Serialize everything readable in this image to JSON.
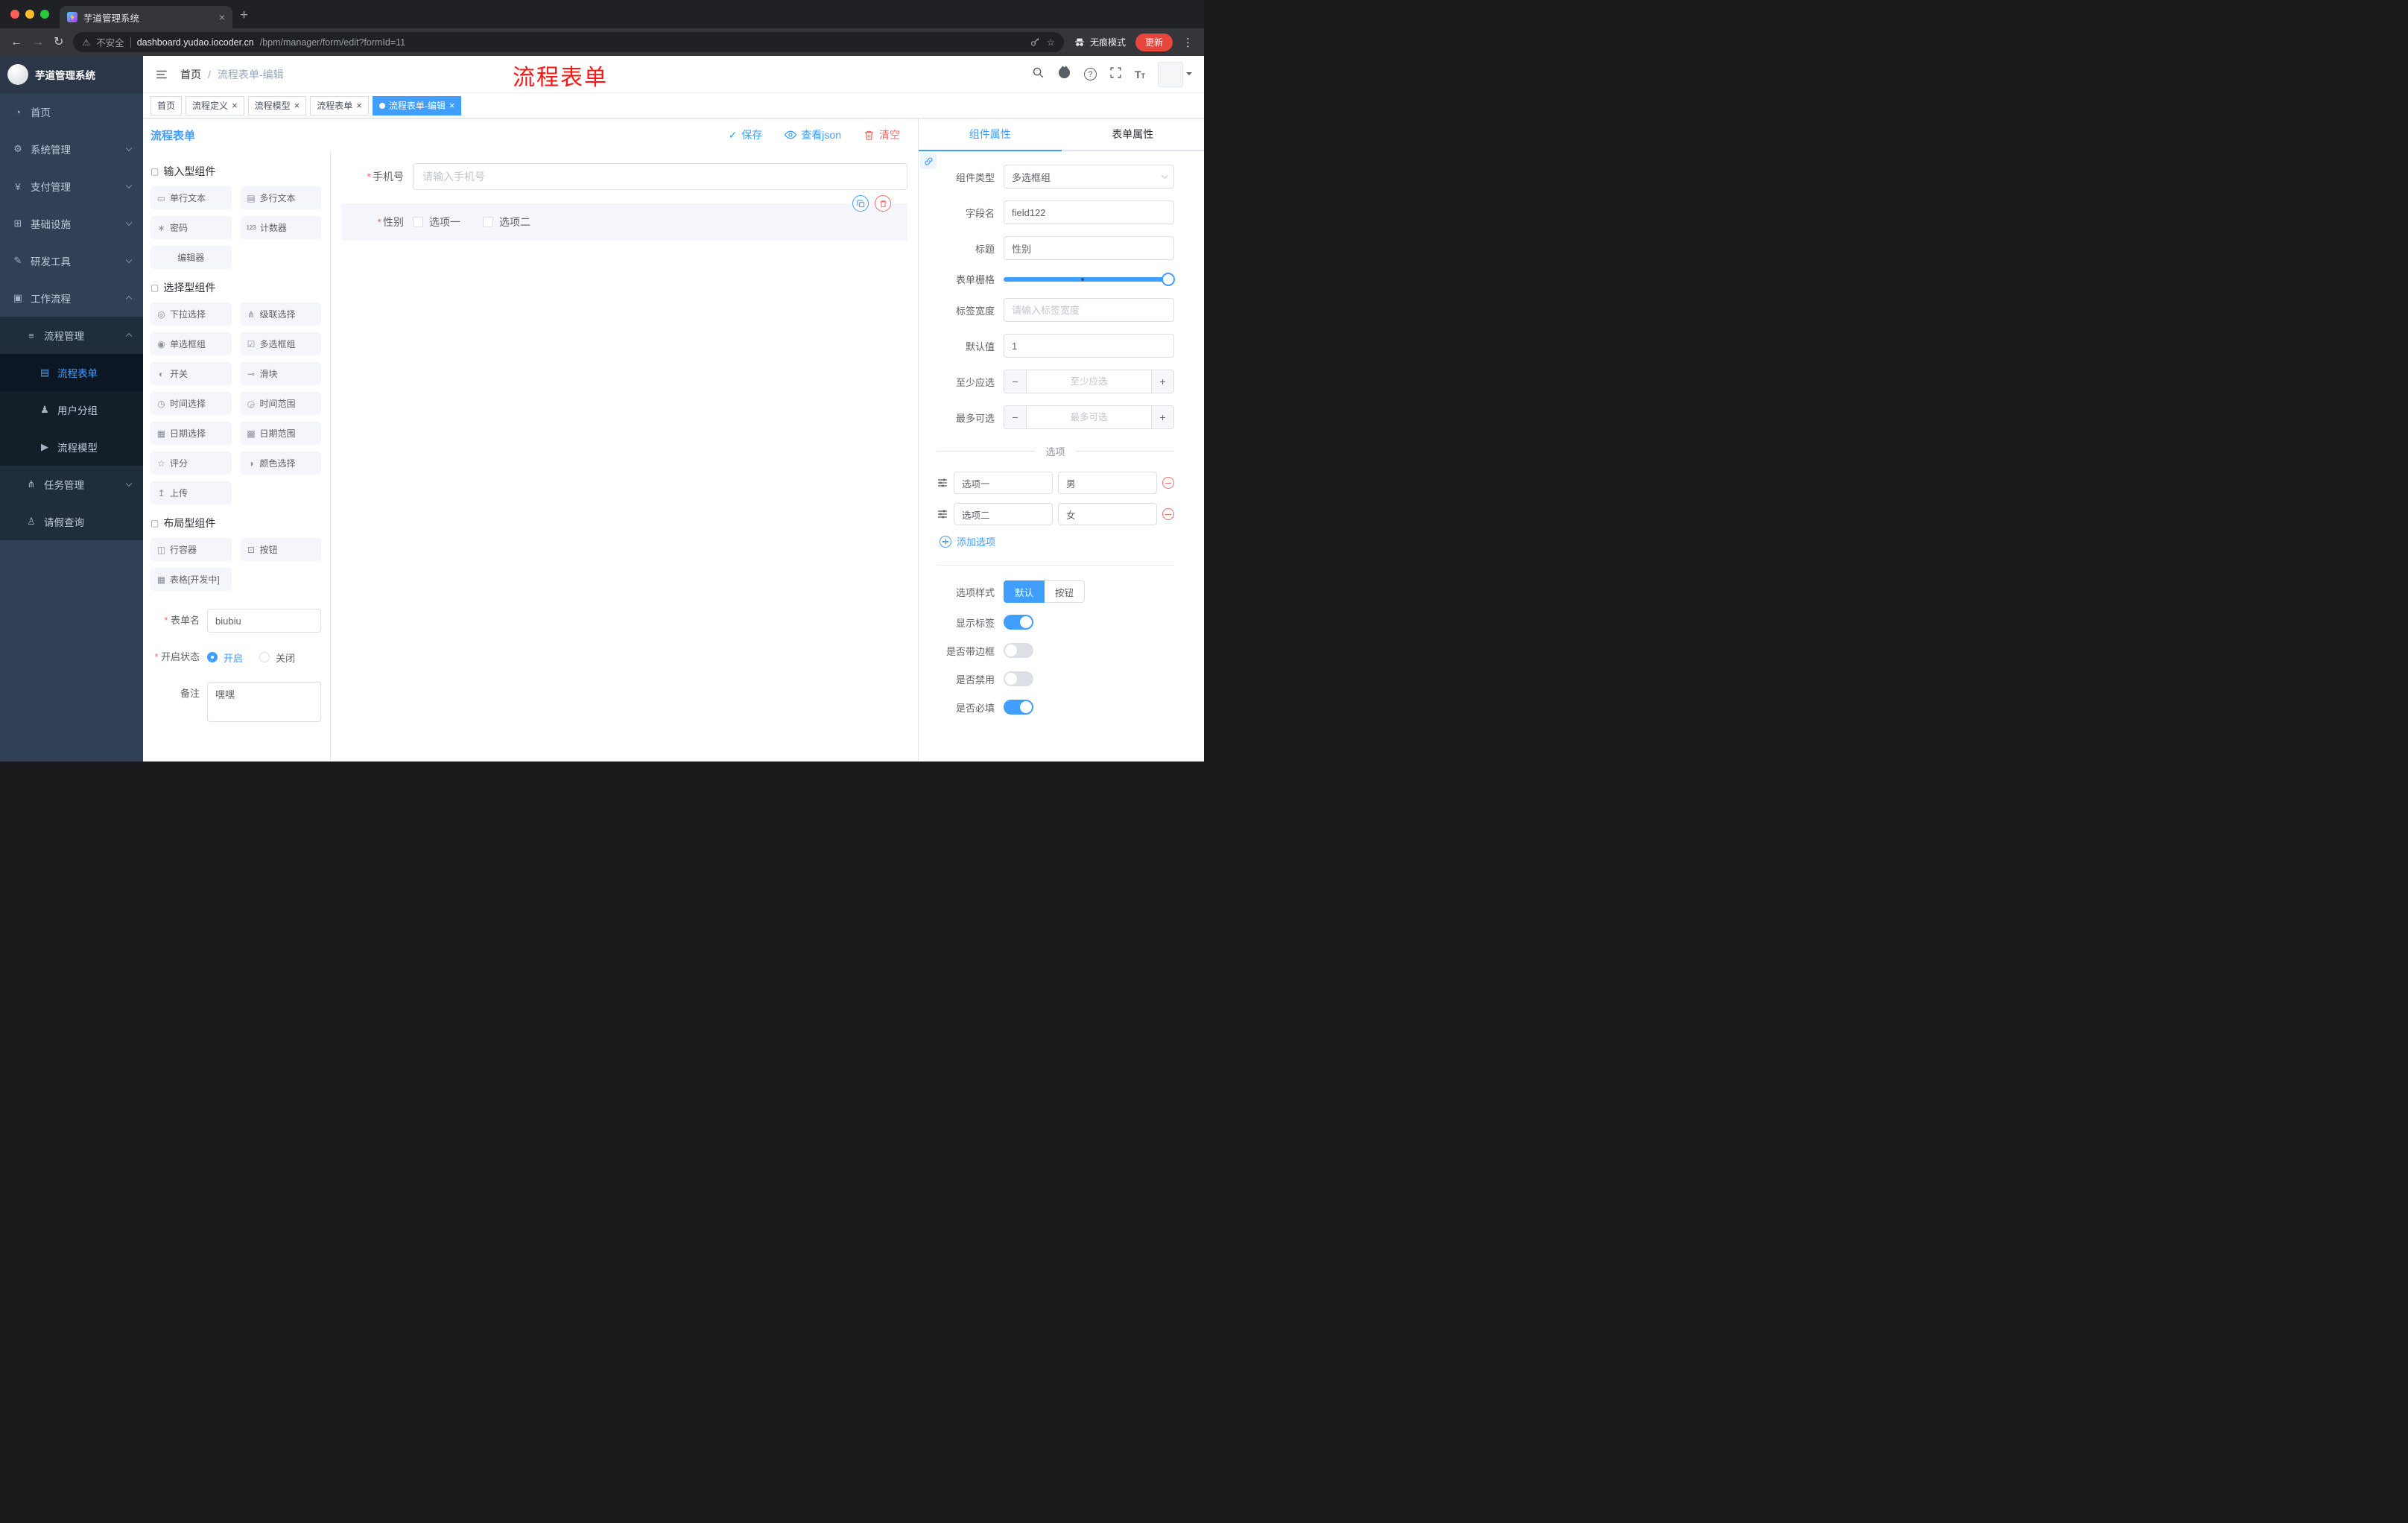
{
  "browser": {
    "tab_title": "芋道管理系统",
    "security_label": "不安全",
    "url_domain": "dashboard.yudao.iocoder.cn",
    "url_path": "/bpm/manager/form/edit?formId=11",
    "incognito_label": "无痕模式",
    "update_label": "更新"
  },
  "sidebar": {
    "logo_title": "芋道管理系统",
    "items": [
      {
        "label": "首页",
        "icon": "dashboard-icon",
        "glyph": "◔"
      },
      {
        "label": "系统管理",
        "icon": "gear-icon",
        "glyph": "⚙"
      },
      {
        "label": "支付管理",
        "icon": "payment-icon",
        "glyph": "¥"
      },
      {
        "label": "基础设施",
        "icon": "infrastructure-icon",
        "glyph": "⊞"
      },
      {
        "label": "研发工具",
        "icon": "devtools-icon",
        "glyph": "✎"
      },
      {
        "label": "工作流程",
        "icon": "workflow-icon",
        "glyph": "▣"
      },
      {
        "label": "流程管理",
        "icon": "process-management-icon",
        "glyph": "≡"
      },
      {
        "label": "流程表单",
        "icon": "process-form-icon",
        "glyph": "▤"
      },
      {
        "label": "用户分组",
        "icon": "user-group-icon",
        "glyph": "♟"
      },
      {
        "label": "流程模型",
        "icon": "process-model-icon",
        "glyph": "▶"
      },
      {
        "label": "任务管理",
        "icon": "task-management-icon",
        "glyph": "⋔"
      },
      {
        "label": "请假查询",
        "icon": "leave-query-icon",
        "glyph": "♙"
      }
    ]
  },
  "navbar": {
    "breadcrumb_home": "首页",
    "breadcrumb_separator": "/",
    "breadcrumb_current": "流程表单-编辑",
    "annotation": "流程表单"
  },
  "tags": [
    {
      "label": "首页"
    },
    {
      "label": "流程定义"
    },
    {
      "label": "流程模型"
    },
    {
      "label": "流程表单"
    },
    {
      "label": "流程表单-编辑"
    }
  ],
  "page": {
    "title": "流程表单",
    "save_label": "保存",
    "view_json_label": "查看json",
    "clear_label": "清空"
  },
  "palette": {
    "groups": [
      {
        "title": "输入型组件",
        "items": [
          {
            "label": "单行文本",
            "icon": "single-line-text-icon",
            "glyph": "▭"
          },
          {
            "label": "多行文本",
            "icon": "multi-line-text-icon",
            "glyph": "▤"
          },
          {
            "label": "密码",
            "icon": "password-icon",
            "glyph": "∗"
          },
          {
            "label": "计数器",
            "icon": "counter-icon",
            "glyph": "123"
          },
          {
            "label": "编辑器",
            "icon": "editor-icon",
            "glyph": ""
          }
        ]
      },
      {
        "title": "选择型组件",
        "items": [
          {
            "label": "下拉选择",
            "icon": "select-icon",
            "glyph": "◎"
          },
          {
            "label": "级联选择",
            "icon": "cascader-icon",
            "glyph": "⋔"
          },
          {
            "label": "单选框组",
            "icon": "radio-group-icon",
            "glyph": "◉"
          },
          {
            "label": "多选框组",
            "icon": "checkbox-group-icon",
            "glyph": "☑"
          },
          {
            "label": "开关",
            "icon": "switch-icon",
            "glyph": "◐"
          },
          {
            "label": "滑块",
            "icon": "slider-icon",
            "glyph": "⊸"
          },
          {
            "label": "时间选择",
            "icon": "time-picker-icon",
            "glyph": "◷"
          },
          {
            "label": "时间范围",
            "icon": "time-range-icon",
            "glyph": "◶"
          },
          {
            "label": "日期选择",
            "icon": "date-picker-icon",
            "glyph": "▦"
          },
          {
            "label": "日期范围",
            "icon": "date-range-icon",
            "glyph": "▩"
          },
          {
            "label": "评分",
            "icon": "rate-icon",
            "glyph": "☆"
          },
          {
            "label": "颜色选择",
            "icon": "color-picker-icon",
            "glyph": "◑"
          },
          {
            "label": "上传",
            "icon": "upload-icon",
            "glyph": "↥"
          }
        ]
      },
      {
        "title": "布局型组件",
        "items": [
          {
            "label": "行容器",
            "icon": "row-container-icon",
            "glyph": "◫"
          },
          {
            "label": "按钮",
            "icon": "button-icon",
            "glyph": "⊡"
          },
          {
            "label": "表格[开发中]",
            "icon": "table-icon",
            "glyph": "▦"
          }
        ]
      }
    ],
    "form": {
      "name_label": "表单名",
      "name_value": "biubiu",
      "status_label": "开启状态",
      "status_on": "开启",
      "status_off": "关闭",
      "remark_label": "备注",
      "remark_value": "嘿嘿"
    }
  },
  "canvas": {
    "phone_label": "手机号",
    "phone_placeholder": "请输入手机号",
    "gender_label": "性别",
    "gender_option1": "选项一",
    "gender_option2": "选项二"
  },
  "panel": {
    "tab_component": "组件属性",
    "tab_form": "表单属性",
    "type_label": "组件类型",
    "type_value": "多选框组",
    "field_label": "字段名",
    "field_value": "field122",
    "title_label": "标题",
    "title_value": "性别",
    "grid_label": "表单栅格",
    "width_label": "标签宽度",
    "width_placeholder": "请输入标签宽度",
    "default_label": "默认值",
    "default_value": "1",
    "min_label": "至少应选",
    "min_placeholder": "至少应选",
    "max_label": "最多可选",
    "max_placeholder": "最多可选",
    "options_divider": "选项",
    "options": [
      {
        "label": "选项一",
        "value": "男"
      },
      {
        "label": "选项二",
        "value": "女"
      }
    ],
    "add_option_label": "添加选项",
    "style_label": "选项样式",
    "style_default": "默认",
    "style_button": "按钮",
    "show_label_label": "显示标签",
    "border_label": "是否带边框",
    "disabled_label": "是否禁用",
    "required_label": "是否必填"
  },
  "colors": {
    "primary": "#409EFF",
    "danger": "#F56C6C",
    "sidebar_bg": "#304156",
    "annotation_red": "#FF1313",
    "update_button": "#E8453C",
    "tag_active": "#409EFF"
  }
}
